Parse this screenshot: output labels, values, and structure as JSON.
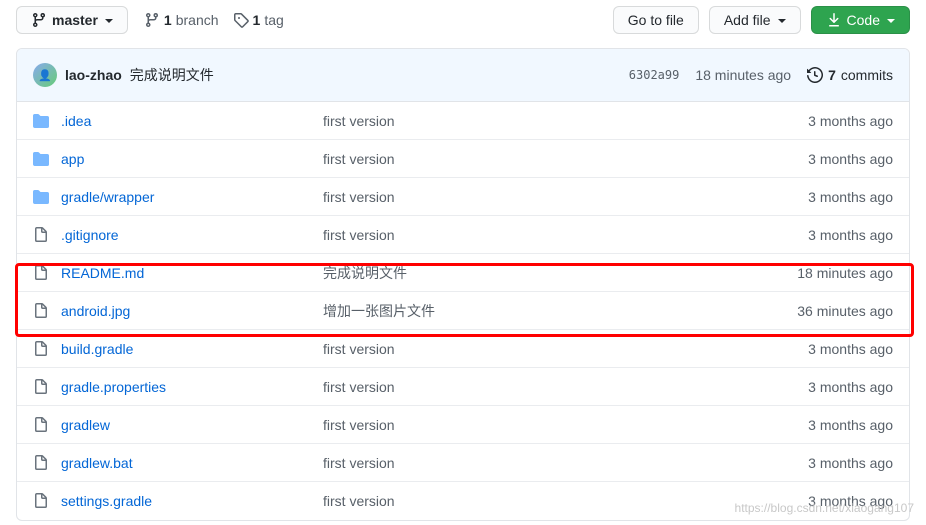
{
  "toolbar": {
    "branch_label": "master",
    "branch_count": "1",
    "branch_word": "branch",
    "tag_count": "1",
    "tag_word": "tag",
    "go_to_file": "Go to file",
    "add_file": "Add file",
    "code": "Code"
  },
  "commit": {
    "author": "lao-zhao",
    "message": "完成说明文件",
    "sha": "6302a99",
    "time": "18 minutes ago",
    "commits_count": "7",
    "commits_word": "commits"
  },
  "files": [
    {
      "type": "folder",
      "name": ".idea",
      "msg": "first version",
      "time": "3 months ago"
    },
    {
      "type": "folder",
      "name": "app",
      "msg": "first version",
      "time": "3 months ago"
    },
    {
      "type": "folder",
      "name": "gradle/wrapper",
      "msg": "first version",
      "time": "3 months ago"
    },
    {
      "type": "file",
      "name": ".gitignore",
      "msg": "first version",
      "time": "3 months ago"
    },
    {
      "type": "file",
      "name": "README.md",
      "msg": "完成说明文件",
      "time": "18 minutes ago"
    },
    {
      "type": "file",
      "name": "android.jpg",
      "msg": "增加一张图片文件",
      "time": "36 minutes ago"
    },
    {
      "type": "file",
      "name": "build.gradle",
      "msg": "first version",
      "time": "3 months ago"
    },
    {
      "type": "file",
      "name": "gradle.properties",
      "msg": "first version",
      "time": "3 months ago"
    },
    {
      "type": "file",
      "name": "gradlew",
      "msg": "first version",
      "time": "3 months ago"
    },
    {
      "type": "file",
      "name": "gradlew.bat",
      "msg": "first version",
      "time": "3 months ago"
    },
    {
      "type": "file",
      "name": "settings.gradle",
      "msg": "first version",
      "time": "3 months ago"
    }
  ],
  "watermark": "https://blog.csdn.net/xiaogang107"
}
